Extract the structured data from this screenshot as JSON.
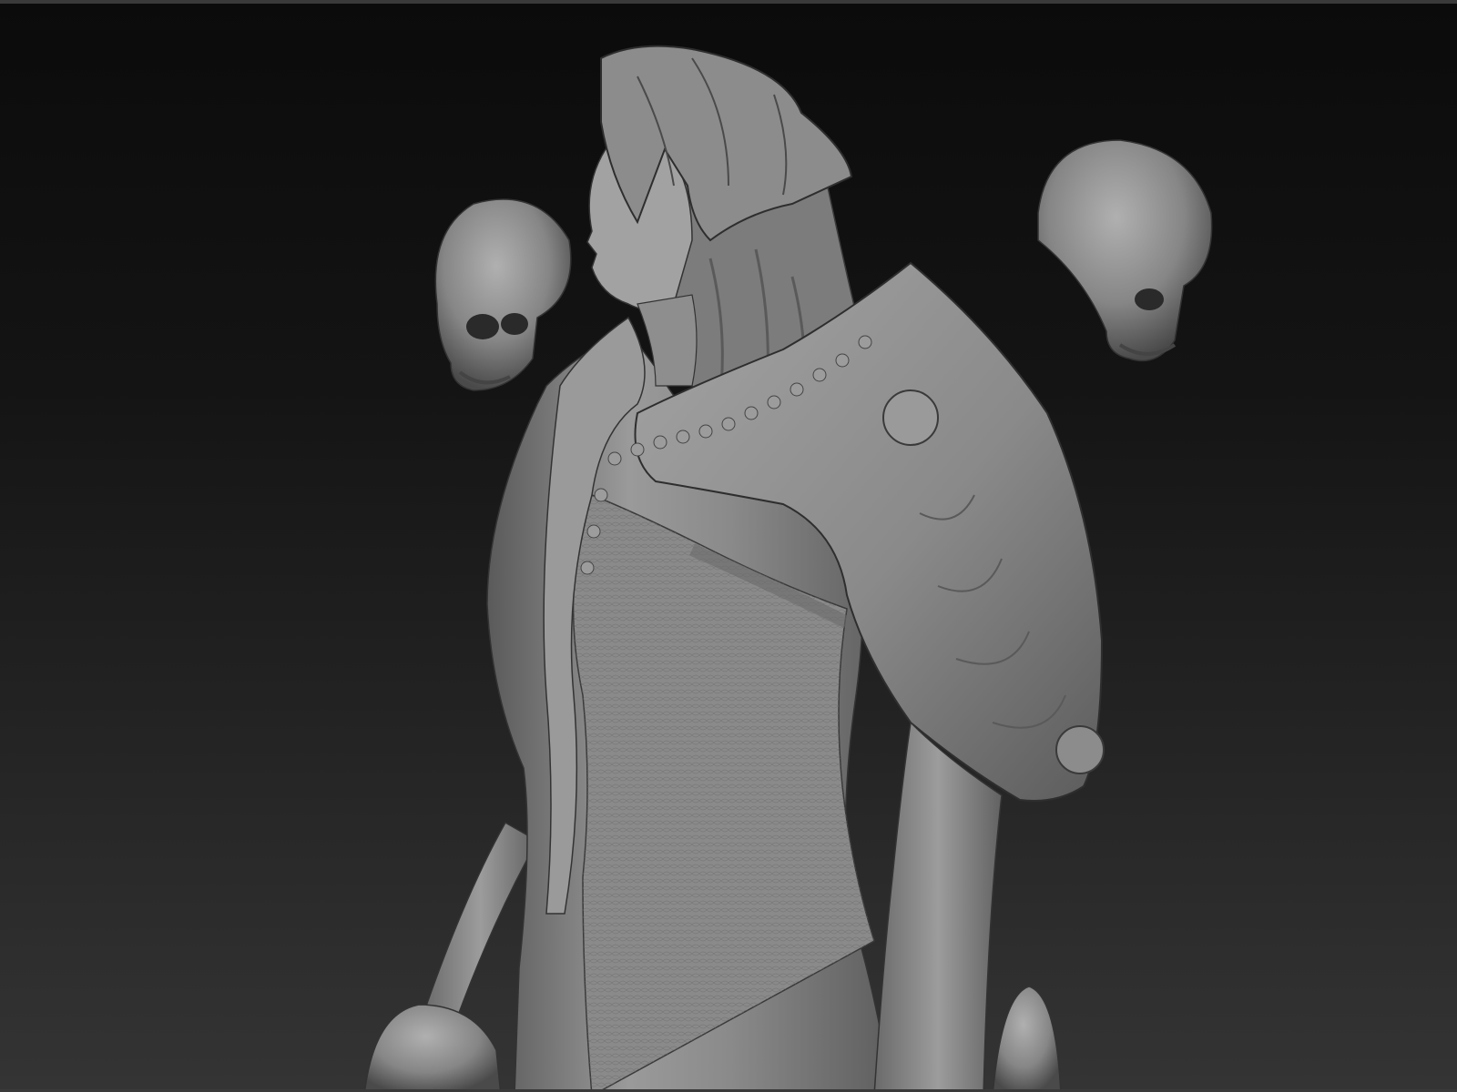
{
  "viewport": {
    "background_top": "#0b0b0b",
    "background_bottom": "#343434",
    "model_tone": "#8e8e8e"
  }
}
